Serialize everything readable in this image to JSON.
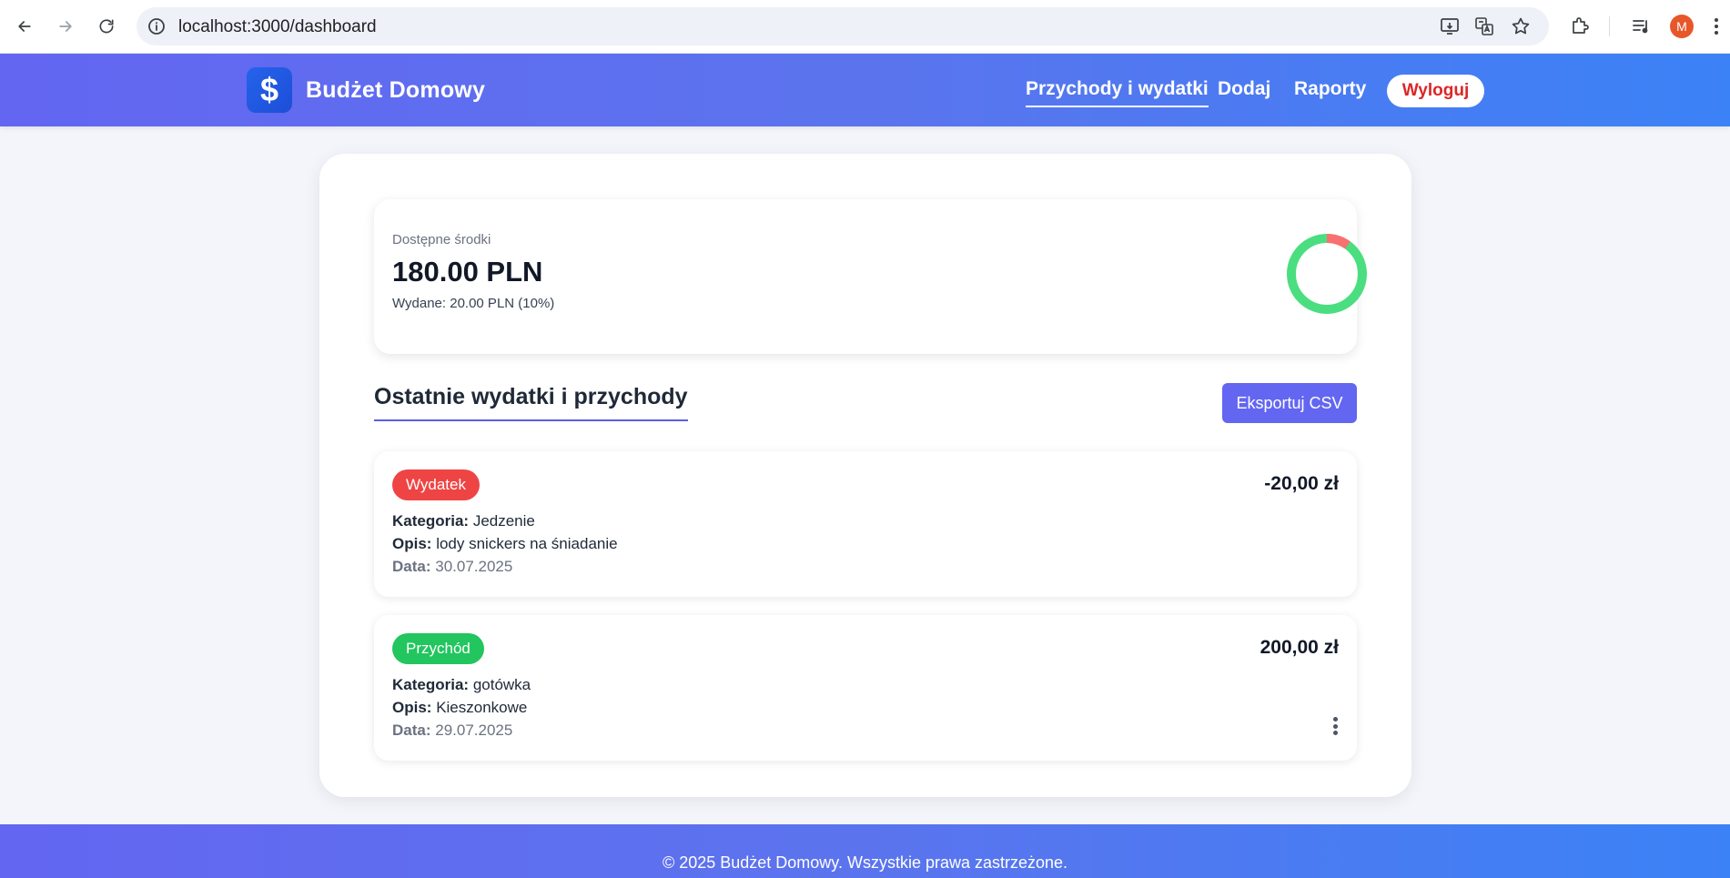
{
  "browser": {
    "url": "localhost:3000/dashboard",
    "profile_initial": "M"
  },
  "header": {
    "logo_symbol": "$",
    "brand": "Budżet Domowy",
    "nav": [
      {
        "label": "Przychody i wydatki",
        "active": true
      },
      {
        "label": "Dodaj",
        "active": false
      },
      {
        "label": "Raporty",
        "active": false
      }
    ],
    "logout_label": "Wyloguj"
  },
  "balance": {
    "label": "Dostępne środki",
    "amount": "180.00 PLN",
    "spent_text": "Wydane: 20.00 PLN (10%)",
    "spent_fraction": 0.1,
    "colors": {
      "available": "#4ade80",
      "spent": "#f87171"
    }
  },
  "section": {
    "title": "Ostatnie wydatki i przychody",
    "export_label": "Eksportuj CSV"
  },
  "transactions": [
    {
      "type": "Wydatek",
      "type_color": "#ef4444",
      "amount": "-20,00 zł",
      "category_label": "Kategoria:",
      "category": "Jedzenie",
      "description_label": "Opis:",
      "description": "lody snickers na śniadanie",
      "date_label": "Data:",
      "date": "30.07.2025"
    },
    {
      "type": "Przychód",
      "type_color": "#22c55e",
      "amount": "200,00 zł",
      "category_label": "Kategoria:",
      "category": "gotówka",
      "description_label": "Opis:",
      "description": "Kieszonkowe",
      "date_label": "Data:",
      "date": "29.07.2025"
    }
  ],
  "footer": {
    "text": "© 2025 Budżet Domowy. Wszystkie prawa zastrzeżone."
  }
}
